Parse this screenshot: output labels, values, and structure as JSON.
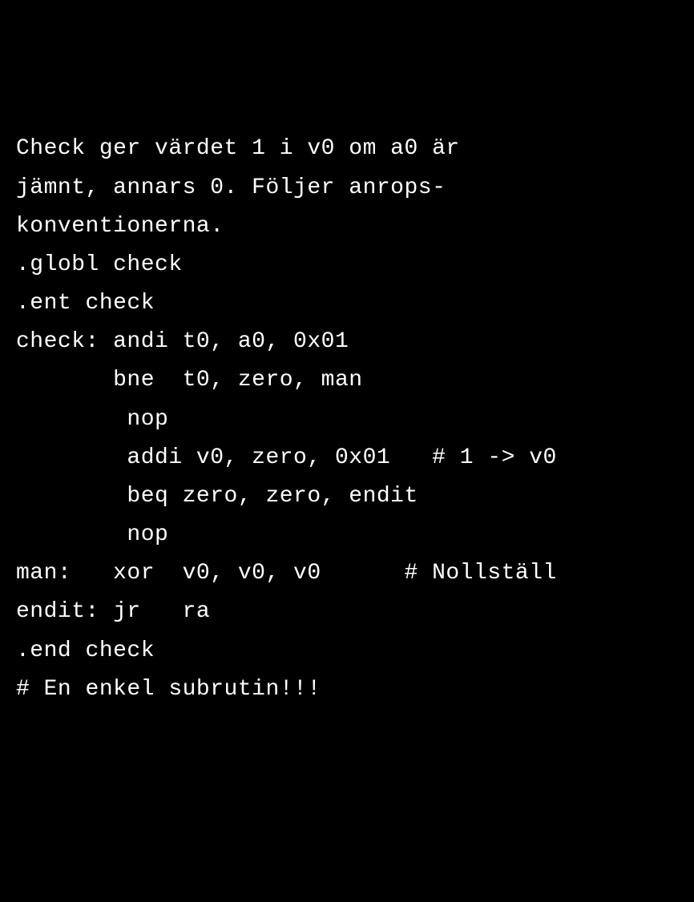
{
  "code": {
    "l1": "Check ger värdet 1 i v0 om a0 är",
    "l2": "jämnt, annars 0. Följer anrops-",
    "l3": "konventionerna.",
    "l4": "",
    "l5": ".globl check",
    "l6": ".ent check",
    "l7": "check: andi t0, a0, 0x01",
    "l8": "       bne  t0, zero, man",
    "l9": "        nop",
    "l10": "        addi v0, zero, 0x01   # 1 -> v0",
    "l11": "        beq zero, zero, endit",
    "l12": "        nop",
    "l13": "man:   xor  v0, v0, v0      # Nollställ",
    "l14": "endit: jr   ra",
    "l15": ".end check",
    "l16": "",
    "l17": "# En enkel subrutin!!!"
  }
}
